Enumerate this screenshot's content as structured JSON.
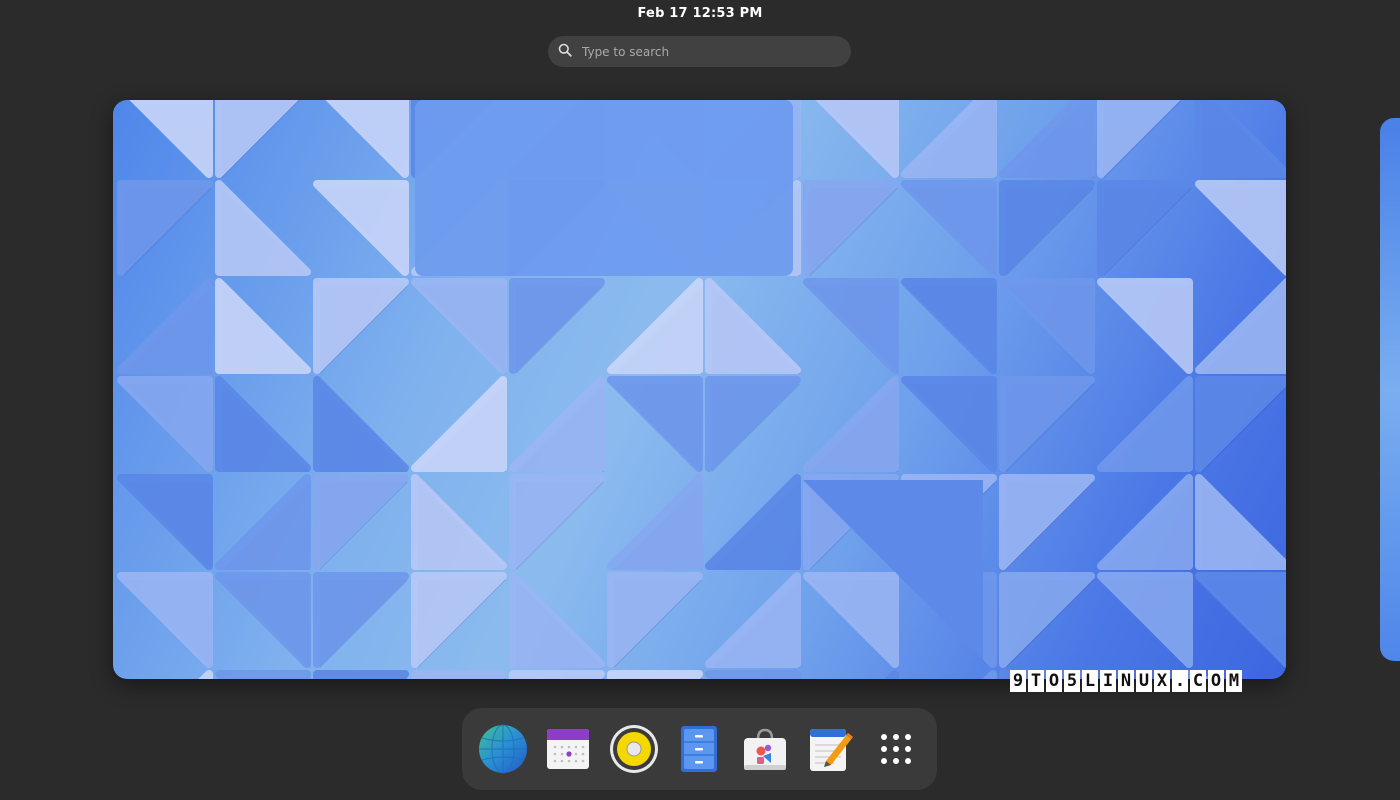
{
  "topbar": {
    "clock": "Feb 17  12:53 PM"
  },
  "search": {
    "placeholder": "Type to search",
    "icon": "search-icon"
  },
  "watermark": {
    "chars": [
      "9",
      "T",
      "O",
      "5",
      "L",
      "I",
      "N",
      "U",
      "X",
      ".",
      "C",
      "O",
      "M"
    ]
  },
  "dock": {
    "items": [
      {
        "name": "web-browser",
        "icon": "globe-icon"
      },
      {
        "name": "calendar",
        "icon": "calendar-icon"
      },
      {
        "name": "music-player",
        "icon": "speaker-icon"
      },
      {
        "name": "file-manager",
        "icon": "file-cabinet-icon"
      },
      {
        "name": "software-store",
        "icon": "shopping-bag-icon"
      },
      {
        "name": "text-editor",
        "icon": "notepad-pencil-icon"
      },
      {
        "name": "show-apps",
        "icon": "app-grid-icon"
      }
    ]
  },
  "colors": {
    "background": "#2b2b2b",
    "dock": "#3a3a3a",
    "search": "#414141",
    "wallpaper_accent": "#4f86ea"
  }
}
